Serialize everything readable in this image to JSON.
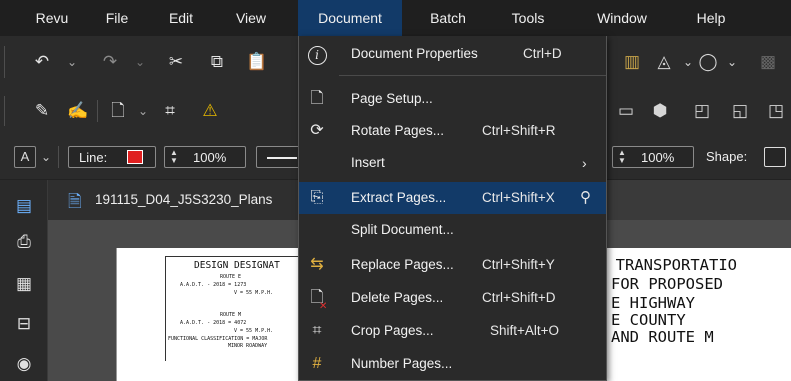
{
  "menubar": {
    "items": [
      "Revu",
      "File",
      "Edit",
      "View",
      "Document",
      "Batch",
      "Tools",
      "Window",
      "Help"
    ],
    "active_index": 4,
    "active_color": "#123a68"
  },
  "toolbar1": {
    "icons": [
      "undo-icon",
      "undo-dropdown-icon",
      "redo-icon",
      "redo-dropdown-icon",
      "cut-icon",
      "copy-icon",
      "paste-icon"
    ]
  },
  "toolbar2": {
    "icons": [
      "pen-icon",
      "signature-icon",
      "page-icon",
      "page-dropdown-icon",
      "crop-icon",
      "highlight-icon"
    ]
  },
  "propbar": {
    "font_button": "A",
    "line_label": "Line:",
    "line_color": "#e02020",
    "line_opacity": "100%",
    "right_opacity": "100%",
    "shape_label": "Shape:"
  },
  "document_tab": {
    "filename": "191115_D04_J5S3230_Plans"
  },
  "dropdown": {
    "items": [
      {
        "label": "Document Properties",
        "shortcut": "Ctrl+D",
        "icon": "info-icon"
      },
      {
        "label": "Page Setup...",
        "shortcut": "",
        "icon": "page-setup-icon"
      },
      {
        "label": "Rotate Pages...",
        "shortcut": "Ctrl+Shift+R",
        "icon": "rotate-pages-icon"
      },
      {
        "label": "Insert",
        "shortcut": "",
        "icon": "",
        "submenu": true
      },
      {
        "label": "Extract Pages...",
        "shortcut": "Ctrl+Shift+X",
        "icon": "extract-pages-icon",
        "highlighted": true,
        "pinned": true
      },
      {
        "label": "Split Document...",
        "shortcut": "",
        "icon": ""
      },
      {
        "label": "Replace Pages...",
        "shortcut": "Ctrl+Shift+Y",
        "icon": "replace-pages-icon"
      },
      {
        "label": "Delete Pages...",
        "shortcut": "Ctrl+Shift+D",
        "icon": "delete-pages-icon"
      },
      {
        "label": "Crop Pages...",
        "shortcut": "Shift+Alt+O",
        "icon": "crop-pages-icon"
      },
      {
        "label": "Number Pages...",
        "shortcut": "",
        "icon": "number-pages-icon"
      }
    ]
  },
  "drawing": {
    "left_block": {
      "title": "DESIGN DESIGNAT",
      "route_e": "ROUTE E",
      "aadt_e": "A.A.D.T. - 2018 = 1273",
      "v_e": "V = 55 M.P.H.",
      "route_m": "ROUTE M",
      "aadt_m": "A.A.D.T. - 2018 = 4072",
      "v_m": "V = 55 M.P.H.",
      "classification": "FUNCTIONAL CLASSIFICATION = MAJOR",
      "classification2": "MINOR ROADWAY"
    },
    "right_block": {
      "line1": "D TRANSPORTATIO",
      "line2": "FOR PROPOSED",
      "line3": "E HIGHWAY",
      "line4": "E COUNTY",
      "line5": "AND ROUTE M"
    }
  }
}
